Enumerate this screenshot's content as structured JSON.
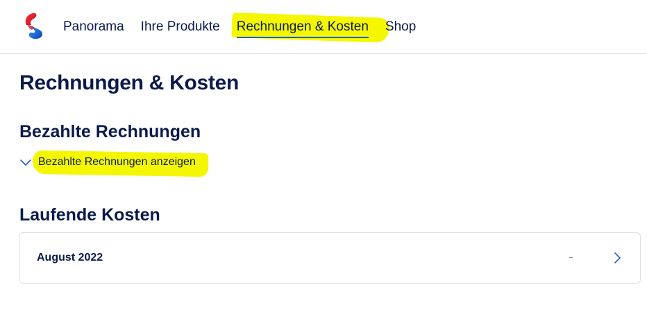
{
  "header": {
    "logo": "swisscom-logo",
    "nav": [
      {
        "label": "Panorama",
        "active": false
      },
      {
        "label": "Ihre Produkte",
        "active": false
      },
      {
        "label": "Rechnungen & Kosten",
        "active": true
      },
      {
        "label": "Shop",
        "active": false
      }
    ]
  },
  "main": {
    "title": "Rechnungen & Kosten",
    "paid_bills": {
      "heading": "Bezahlte Rechnungen",
      "toggle_label": "Bezahlte Rechnungen anzeigen",
      "toggle_icon": "chevron-down-icon"
    },
    "running_costs": {
      "heading": "Laufende Kosten",
      "items": [
        {
          "period": "August 2022",
          "amount": "–",
          "icon": "chevron-right-icon"
        }
      ]
    }
  },
  "colors": {
    "text": "#0a1a4a",
    "accent": "#1f5dd4",
    "highlight": "#f4f700",
    "border": "#dcdfe6"
  }
}
